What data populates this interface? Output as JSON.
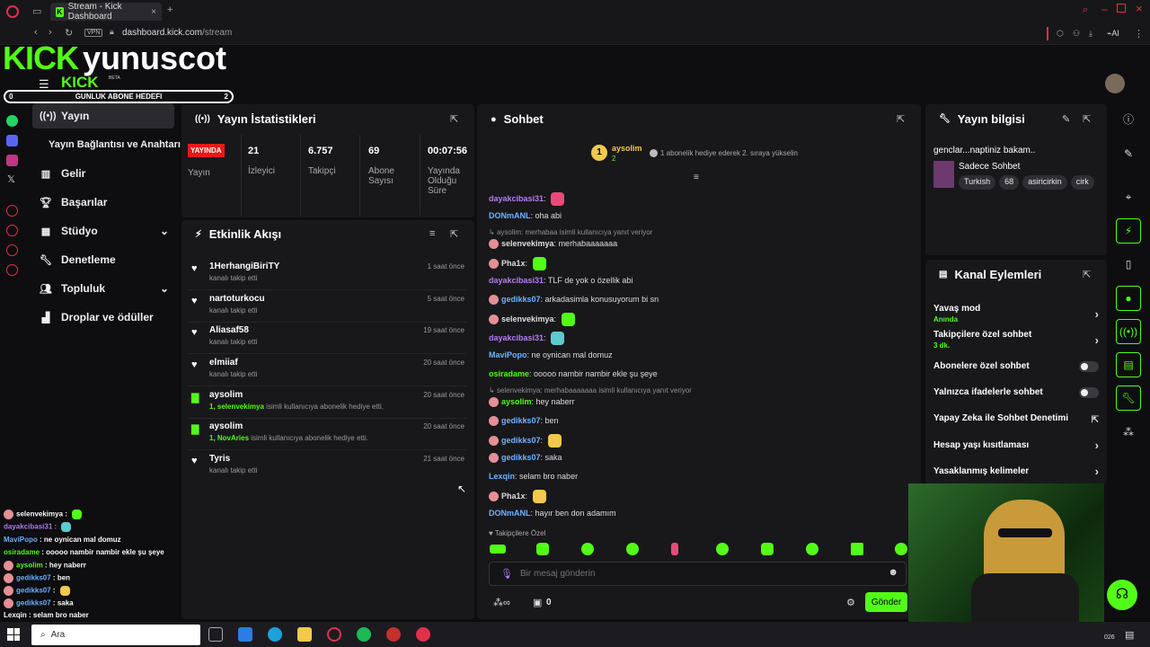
{
  "browser": {
    "tab_title": "Stream - Kick Dashboard",
    "url_domain": "dashboard.kick.com",
    "url_path": "/stream",
    "vpn": "VPN",
    "ai": "AI"
  },
  "overlay": {
    "brand": "KICK",
    "channel": "yunuscot",
    "brand_small": "KICK",
    "beta": "BETA",
    "goal_label": "GUNLUK ABONE HEDEFI",
    "goal_left": "0",
    "goal_right": "2"
  },
  "sidebar": {
    "items": [
      {
        "label": "Yayın",
        "icon": "broadcast-icon"
      },
      {
        "label": "Yayın Bağlantısı ve Anahtarı",
        "icon": ""
      },
      {
        "label": "Gelir",
        "icon": "chart-icon"
      },
      {
        "label": "Başarılar",
        "icon": "trophy-icon"
      },
      {
        "label": "Stüdyo",
        "icon": "layout-icon"
      },
      {
        "label": "Denetleme",
        "icon": "wrench-icon"
      },
      {
        "label": "Topluluk",
        "icon": "people-icon"
      },
      {
        "label": "Droplar ve ödüller",
        "icon": "gift-icon"
      }
    ]
  },
  "stats": {
    "title": "Yayın İstatistikleri",
    "live": "YAYINDA",
    "live_label": "Yayın",
    "items": [
      {
        "value": "21",
        "label": "İzleyici"
      },
      {
        "value": "6.757",
        "label": "Takipçi"
      },
      {
        "value": "69",
        "label": "Abone Sayısı"
      },
      {
        "value": "00:07:56",
        "label": "Yayında Olduğu Süre"
      }
    ]
  },
  "activity": {
    "title": "Etkinlik Akışı",
    "rows": [
      {
        "name": "1HerhangiBiriTY",
        "sub": "kanalı takip etti",
        "time": "1 saat önce",
        "type": "follow"
      },
      {
        "name": "nartoturkocu",
        "sub": "kanalı takip etti",
        "time": "5 saat önce",
        "type": "follow"
      },
      {
        "name": "Aliasaf58",
        "sub": "kanalı takip etti",
        "time": "19 saat önce",
        "type": "follow"
      },
      {
        "name": "elmiiaf",
        "sub": "kanalı takip etti",
        "time": "20 saat önce",
        "type": "follow"
      },
      {
        "name": "aysolim",
        "sub_pre": "1, selenvekimya",
        "sub": " isimli kullanıcıya abonelik hediye etti.",
        "time": "20 saat önce",
        "type": "gift"
      },
      {
        "name": "aysolim",
        "sub_pre": "1, NovAries",
        "sub": " isimli kullanıcıya abonelik hediye etti.",
        "time": "20 saat önce",
        "type": "gift"
      },
      {
        "name": "Tyris",
        "sub": "kanalı takip etti",
        "time": "21 saat önce",
        "type": "follow"
      }
    ]
  },
  "chat": {
    "title": "Sohbet",
    "top_user": "aysolim",
    "top_rank": "1",
    "top_count": "2",
    "top_hint": "1 abonelik hediye ederek 2. sıraya yükselin",
    "messages": [
      {
        "user": "dayakcibasi31",
        "text": "",
        "color": "#b57cf2",
        "badge": false,
        "emote": "#e84b7a"
      },
      {
        "user": "DONmANL",
        "text": "oha abi",
        "color": "#6fb3ff",
        "badge": false
      },
      {
        "reply": "aysolim: merhabaa isimli kullanıcıya yanıt veriyor"
      },
      {
        "user": "selenvekimya",
        "text": "merhabaaaaaaa",
        "color": "#fff",
        "badge": true
      },
      {
        "user": "Pha1x",
        "text": "",
        "color": "#fff",
        "badge": true,
        "emote": "#53fc18"
      },
      {
        "user": "dayakcibasi31",
        "text": "TLF de yok o özellik abi",
        "color": "#b57cf2",
        "badge": false
      },
      {
        "user": "gedikks07",
        "text": "arkadasimla konusuyorum bi sn",
        "color": "#6fb3ff",
        "badge": true
      },
      {
        "user": "selenvekimya",
        "text": "",
        "color": "#fff",
        "badge": true,
        "emote": "#53fc18"
      },
      {
        "user": "dayakcibasi31",
        "text": "",
        "color": "#b57cf2",
        "badge": false,
        "emote": "#5ccbd0"
      },
      {
        "user": "MaviPopo",
        "text": "ne oynican mal domuz",
        "color": "#6fb3ff",
        "badge": false
      },
      {
        "user": "osiradame",
        "text": "ooooo nambir nambir ekle şu şeye",
        "color": "#53fc18",
        "badge": false
      },
      {
        "reply": "selenvekimya: merhabaaaaaaa isimli kullanıcıya yanıt veriyor"
      },
      {
        "user": "aysolim",
        "text": "hey naberr",
        "color": "#53fc18",
        "badge": true
      },
      {
        "user": "gedikks07",
        "text": "ben",
        "color": "#6fb3ff",
        "badge": true
      },
      {
        "user": "gedikks07",
        "text": "",
        "color": "#6fb3ff",
        "badge": true,
        "emote": "#f2c94c"
      },
      {
        "user": "gedikks07",
        "text": "saka",
        "color": "#6fb3ff",
        "badge": true
      },
      {
        "user": "Lexqin",
        "text": "selam bro naber",
        "color": "#6fb3ff",
        "badge": false
      },
      {
        "user": "Pha1x",
        "text": "",
        "color": "#fff",
        "badge": true,
        "emote": "#f2c94c"
      },
      {
        "user": "DONmANL",
        "text": "hayır ben don adamım",
        "color": "#6fb3ff",
        "badge": false
      }
    ],
    "followers_only": "Takipçilere Özel",
    "placeholder": "Bir mesaj gönderin",
    "send": "Gönder",
    "points": "0"
  },
  "info": {
    "title": "Yayın bilgisi",
    "stream_title": "genclar...naptiniz bakam..",
    "category": "Sadece Sohbet",
    "tags": [
      "Turkish",
      "68",
      "asiricirkin",
      "cirk"
    ]
  },
  "actions": {
    "title": "Kanal Eylemleri",
    "items": [
      {
        "label": "Yavaş mod",
        "sub": "Anında",
        "control": "chevron"
      },
      {
        "label": "Takipçilere özel sohbet",
        "sub": "3 dk.",
        "control": "chevron"
      },
      {
        "label": "Abonelere özel sohbet",
        "sub": "",
        "control": "toggle"
      },
      {
        "label": "Yalnızca ifadelerle sohbet",
        "sub": "",
        "control": "toggle"
      },
      {
        "label": "Yapay Zeka ile Sohbet Denetimi",
        "sub": "",
        "control": "external"
      },
      {
        "label": "Hesap yaşı kısıtlaması",
        "sub": "",
        "control": "chevron"
      },
      {
        "label": "Yasaklanmış kelimeler",
        "sub": "",
        "control": "chevron"
      }
    ]
  },
  "overlay_chat": [
    {
      "user": "selenvekimya",
      "text": "",
      "color": "#fff"
    },
    {
      "user": "dayakcibasi31",
      "text": "",
      "color": "#b57cf2"
    },
    {
      "user": "MaviPopo",
      "text": "ne oynican mal domuz",
      "color": "#6fb3ff"
    },
    {
      "user": "osiradame",
      "text": "ooooo nambir nambir ekle şu şeye",
      "color": "#53fc18"
    },
    {
      "user": "aysolim",
      "text": "hey naberr",
      "color": "#53fc18"
    },
    {
      "user": "gedikks07",
      "text": "ben",
      "color": "#6fb3ff"
    },
    {
      "user": "gedikks07",
      "text": "",
      "color": "#6fb3ff"
    },
    {
      "user": "gedikks07",
      "text": "saka",
      "color": "#6fb3ff"
    },
    {
      "user": "Lexqin",
      "text": "selam bro naber",
      "color": "#fff"
    }
  ],
  "taskbar": {
    "search": "Ara",
    "time": "026"
  },
  "colors": {
    "accent": "#53fc18",
    "panel": "#18181b",
    "live": "#e91916"
  }
}
